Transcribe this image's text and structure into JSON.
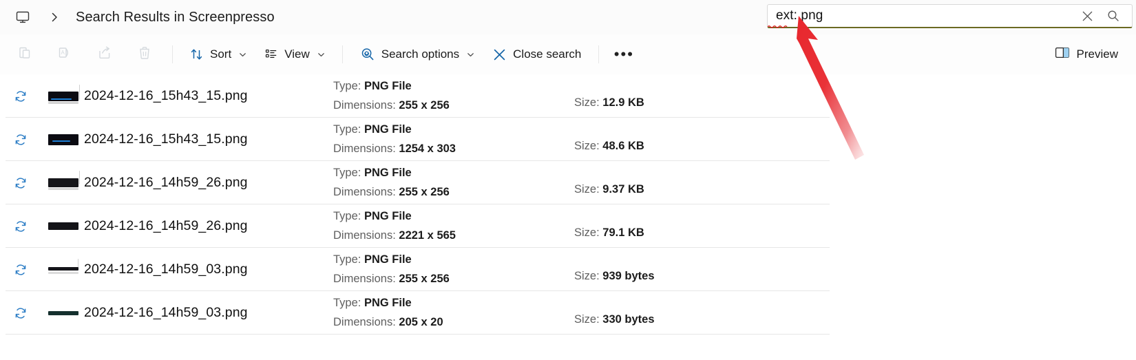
{
  "window": {
    "address_icon": "monitor-icon",
    "breadcrumb_separator": "›",
    "title": "Search Results in Screenpresso"
  },
  "search": {
    "value": "ext:.png",
    "misspelled_part": "ext",
    "clear_icon": "close-icon",
    "search_icon": "search-icon",
    "focus_underline_color": "#6b6a23"
  },
  "toolbar": {
    "icon_buttons": [
      {
        "name": "paste-button",
        "icon": "clipboard-paste-icon",
        "disabled": true
      },
      {
        "name": "rename-button",
        "icon": "rename-document-icon",
        "disabled": true
      },
      {
        "name": "share-button",
        "icon": "share-icon",
        "disabled": true
      },
      {
        "name": "delete-button",
        "icon": "trash-icon",
        "disabled": true
      }
    ],
    "sort_label": "Sort",
    "view_label": "View",
    "search_options_label": "Search options",
    "close_search_label": "Close search",
    "overflow_label": "•••",
    "preview_label": "Preview",
    "accent_color": "#0d6cc4"
  },
  "files": {
    "type_label": "Type:",
    "dimensions_label": "Dimensions:",
    "size_label": "Size:",
    "rows": [
      {
        "name": "2024-12-16_15h43_15.png",
        "type": "PNG File",
        "dimensions": "255 x 256",
        "size": "12.9 KB",
        "sync_icon": "onedrive-sync-icon",
        "thumb": "wide-dark-screenshot"
      },
      {
        "name": "2024-12-16_15h43_15.png",
        "type": "PNG File",
        "dimensions": "1254 x 303",
        "size": "48.6 KB",
        "sync_icon": "onedrive-sync-icon",
        "thumb": "wide-dark-screenshot"
      },
      {
        "name": "2024-12-16_14h59_26.png",
        "type": "PNG File",
        "dimensions": "255 x 256",
        "size": "9.37 KB",
        "sync_icon": "onedrive-sync-icon",
        "thumb": "wide-dark-screenshot"
      },
      {
        "name": "2024-12-16_14h59_26.png",
        "type": "PNG File",
        "dimensions": "2221 x 565",
        "size": "79.1 KB",
        "sync_icon": "onedrive-sync-icon",
        "thumb": "wide-dark-screenshot"
      },
      {
        "name": "2024-12-16_14h59_03.png",
        "type": "PNG File",
        "dimensions": "255 x 256",
        "size": "939 bytes",
        "sync_icon": "onedrive-sync-icon",
        "thumb": "thin-dark-bar"
      },
      {
        "name": "2024-12-16_14h59_03.png",
        "type": "PNG File",
        "dimensions": "205 x 20",
        "size": "330 bytes",
        "sync_icon": "onedrive-sync-icon",
        "thumb": "thin-dark-bar"
      }
    ]
  },
  "annotation": {
    "arrow_color": "#e8272d",
    "points_to": "search-input"
  }
}
